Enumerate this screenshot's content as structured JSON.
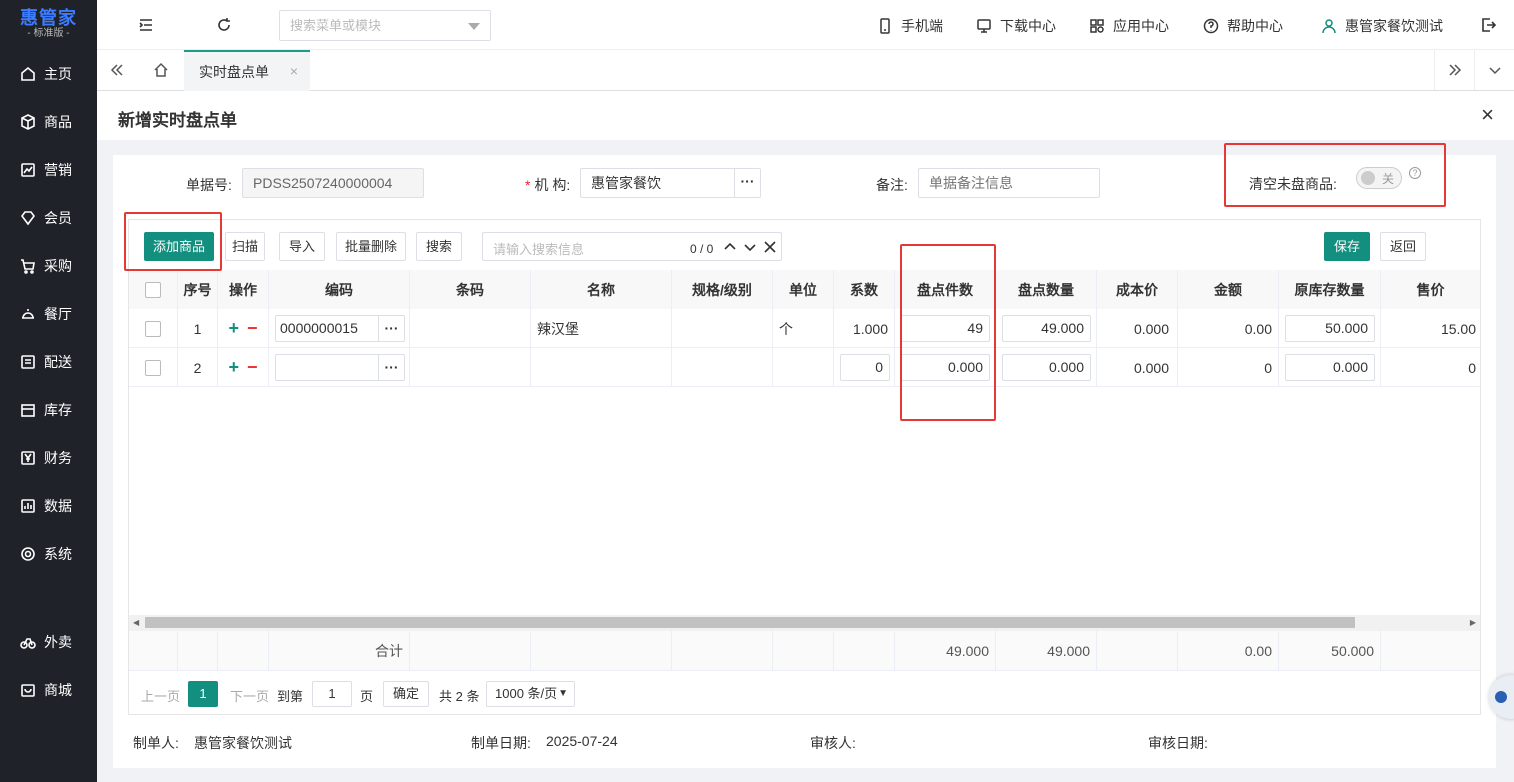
{
  "logo": {
    "main": "惠管家",
    "sub": "- 标准版 -"
  },
  "sidebar": {
    "items": [
      {
        "label": "主页",
        "icon": "home-icon"
      },
      {
        "label": "商品",
        "icon": "box-icon"
      },
      {
        "label": "营销",
        "icon": "chart-icon"
      },
      {
        "label": "会员",
        "icon": "diamond-icon"
      },
      {
        "label": "采购",
        "icon": "cart-icon"
      },
      {
        "label": "餐厅",
        "icon": "cloche-icon"
      },
      {
        "label": "配送",
        "icon": "truck-icon"
      },
      {
        "label": "库存",
        "icon": "warehouse-icon"
      },
      {
        "label": "财务",
        "icon": "yen-icon"
      },
      {
        "label": "数据",
        "icon": "bar-chart-icon"
      },
      {
        "label": "系统",
        "icon": "gear-icon"
      },
      {
        "label": "外卖",
        "icon": "bike-icon"
      },
      {
        "label": "商城",
        "icon": "shop-icon"
      }
    ]
  },
  "topbar": {
    "search_placeholder": "搜索菜单或模块",
    "links": {
      "mobile": "手机端",
      "download": "下载中心",
      "apps": "应用中心",
      "help": "帮助中心",
      "user": "惠管家餐饮测试"
    }
  },
  "tabs": {
    "active": "实时盘点单",
    "close": "×"
  },
  "page": {
    "title": "新增实时盘点单",
    "close": "×"
  },
  "form": {
    "doc_no_label": "单据号:",
    "doc_no_value": "PDSS2507240000004",
    "org_required": "*",
    "org_label": "机 构:",
    "org_value": "惠管家餐饮",
    "remark_label": "备注:",
    "remark_placeholder": "单据备注信息",
    "clear_label": "清空未盘商品:",
    "clear_toggle": "关",
    "help": "?",
    "dots": "···"
  },
  "toolbar": {
    "add": "添加商品",
    "scan": "扫描",
    "import": "导入",
    "batch_delete": "批量删除",
    "search": "搜索",
    "search_placeholder": "请输入搜索信息",
    "search_count": "0 / 0",
    "save": "保存",
    "back": "返回"
  },
  "table": {
    "headers": [
      "序号",
      "操作",
      "编码",
      "条码",
      "名称",
      "规格/级别",
      "单位",
      "系数",
      "盘点件数",
      "盘点数量",
      "成本价",
      "金额",
      "原库存数量",
      "售价"
    ],
    "rows": [
      {
        "no": "1",
        "code": "0000000015",
        "barcode": "",
        "name": "辣汉堡",
        "spec": "",
        "unit": "个",
        "factor": "1.000",
        "count_pieces": "49",
        "count_qty": "49.000",
        "cost": "0.000",
        "amount": "0.00",
        "orig_qty": "50.000",
        "price": "15.00"
      },
      {
        "no": "2",
        "code": "",
        "barcode": "",
        "name": "",
        "spec": "",
        "unit": "",
        "factor": "0",
        "count_pieces": "0.000",
        "count_qty": "0.000",
        "cost": "0.000",
        "amount": "0",
        "orig_qty": "0.000",
        "price": "0"
      }
    ],
    "ops": {
      "plus": "+",
      "minus": "−"
    },
    "totals": {
      "label": "合计",
      "count_pieces": "49.000",
      "count_qty": "49.000",
      "amount": "0.00",
      "orig_qty": "50.000"
    }
  },
  "pager": {
    "prev": "上一页",
    "current": "1",
    "next": "下一页",
    "goto": "到第",
    "page_input": "1",
    "page_unit": "页",
    "confirm": "确定",
    "total": "共 2 条",
    "page_size": "1000 条/页"
  },
  "footer": {
    "creator_label": "制单人:",
    "creator": "惠管家餐饮测试",
    "date_label": "制单日期:",
    "date": "2025-07-24",
    "auditor_label": "审核人:",
    "audit_date_label": "审核日期:"
  },
  "colors": {
    "primary": "#128f7e",
    "sidebar": "#1f2329",
    "highlight": "#e53935"
  }
}
